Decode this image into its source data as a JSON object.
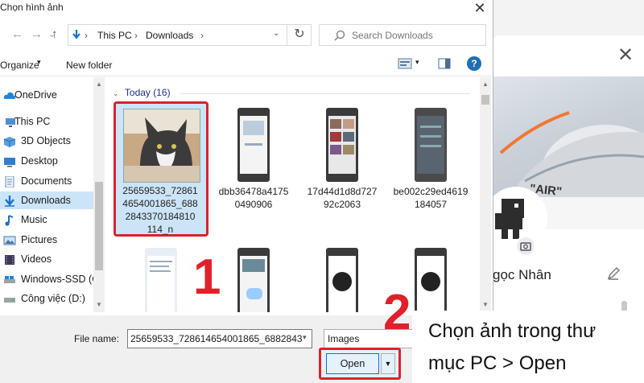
{
  "dialog": {
    "title": "Chọn hình ảnh",
    "breadcrumb": [
      "This PC",
      "Downloads"
    ],
    "search_placeholder": "Search Downloads",
    "toolbar": {
      "organize": "Organize",
      "new_folder": "New folder"
    }
  },
  "nav_items": [
    {
      "label": "OneDrive",
      "icon": "cloud-icon"
    },
    {
      "label": "This PC",
      "icon": "computer-icon"
    },
    {
      "label": "3D Objects",
      "icon": "cube-icon"
    },
    {
      "label": "Desktop",
      "icon": "desktop-icon"
    },
    {
      "label": "Documents",
      "icon": "document-icon"
    },
    {
      "label": "Downloads",
      "icon": "download-icon",
      "selected": true
    },
    {
      "label": "Music",
      "icon": "music-icon"
    },
    {
      "label": "Pictures",
      "icon": "pictures-icon"
    },
    {
      "label": "Videos",
      "icon": "video-icon"
    },
    {
      "label": "Windows-SSD (C",
      "icon": "drive-icon"
    },
    {
      "label": "Công việc (D:)",
      "icon": "drive-icon"
    }
  ],
  "group_header": "Today (16)",
  "files": [
    {
      "name_lines": [
        "25659533_72861",
        "4654001865_688",
        "2843370184810",
        "114_n"
      ],
      "selected": true
    },
    {
      "name_lines": [
        "dbb36478a4175",
        "0490906"
      ]
    },
    {
      "name_lines": [
        "17d44d1d8d727",
        "92c2063"
      ]
    },
    {
      "name_lines": [
        "be002c29ed4619",
        "184057"
      ]
    }
  ],
  "footer": {
    "file_name_label": "File name:",
    "file_name_value": "25659533_728614654001865_6882843",
    "file_type": "Images",
    "open_label": "Open"
  },
  "background_page": {
    "profile_name": "gọc Nhân",
    "photo_text": "\"AIR\""
  },
  "annotations": {
    "step1": "1",
    "step2": "2",
    "caption_line1": "Chọn ảnh trong thư",
    "caption_line2": "mục PC > Open"
  },
  "colors": {
    "highlight": "#d9232d",
    "selection": "#cce4f7",
    "accent": "#0078d7"
  }
}
